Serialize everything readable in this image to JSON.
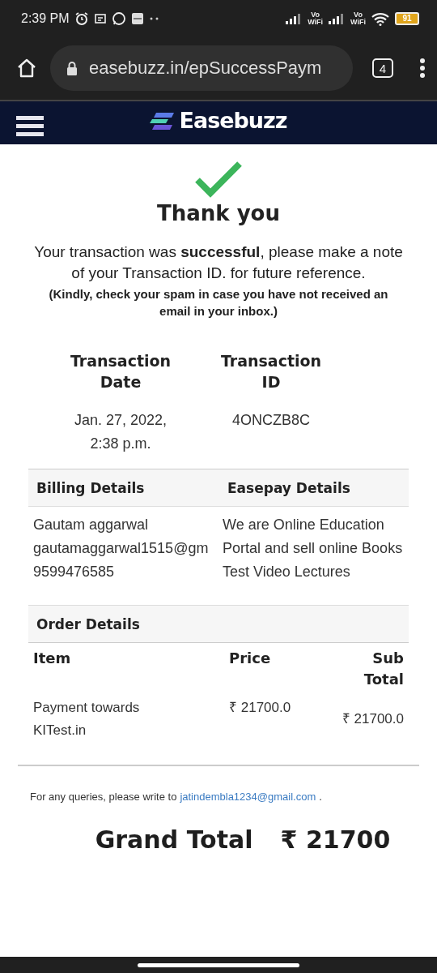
{
  "status_bar": {
    "time": "2:39 PM",
    "network_labels": [
      {
        "top": "Vo",
        "bottom": "WiFi"
      },
      {
        "top": "Vo",
        "bottom": "WiFi"
      }
    ],
    "battery": "91"
  },
  "browser": {
    "url": "easebuzz.in/epSuccessPaym",
    "tab_count": "4"
  },
  "header": {
    "brand": "Easebuzz"
  },
  "success": {
    "title": "Thank you",
    "message": "Your transaction was **successful**, please make a note of your Transaction ID. for future reference.",
    "note": "(Kindly, check your spam in case you have not received an email in your inbox.)"
  },
  "transaction": [
    {
      "heading": "Transaction Date",
      "value": "Jan. 27, 2022, 2:38 p.m."
    },
    {
      "heading": "Transaction ID",
      "value": "4ONCZB8C"
    }
  ],
  "billing": {
    "heading": "Billing Details",
    "lines": [
      "Gautam aggarwal",
      "gautamaggarwal1515@gm",
      "9599476585"
    ]
  },
  "easepay": {
    "heading": "Easepay Details",
    "text": "We are Online Education Portal and sell online Books Test Video Lectures"
  },
  "order": {
    "heading": "Order Details",
    "columns": [
      "Item",
      "Price",
      "Sub Total"
    ],
    "rows": [
      {
        "item": "Payment towards KITest.in",
        "price": "₹ 21700.0",
        "subtotal": "₹ 21700.0"
      }
    ]
  },
  "footer": {
    "text": "For any queries, please write to",
    "email": "jatindembla1234@gmail.com",
    "end": "."
  },
  "grand_total": {
    "label": "Grand Total",
    "amount": "₹ 21700"
  }
}
